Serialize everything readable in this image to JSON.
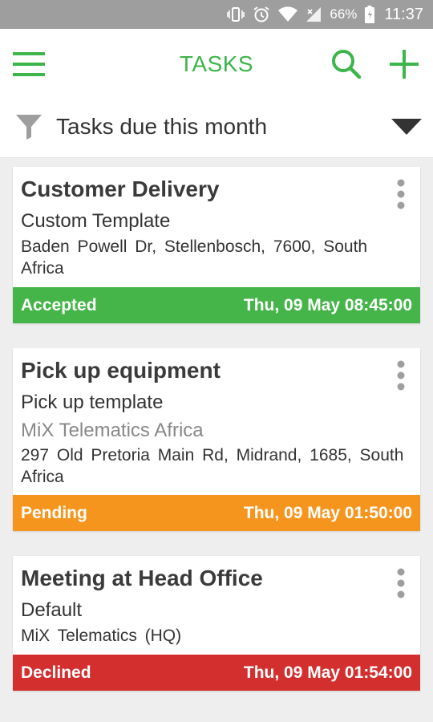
{
  "status_bar": {
    "battery": "66%",
    "time": "11:37",
    "icons": [
      "vibrate-icon",
      "alarm-icon",
      "wifi-icon",
      "signal-icon",
      "battery-icon"
    ]
  },
  "app_bar": {
    "title": "TASKS",
    "accent_color": "#3db54a",
    "icons": [
      "menu-icon",
      "search-icon",
      "add-icon"
    ]
  },
  "filter": {
    "label": "Tasks due this month",
    "icons": [
      "filter-icon",
      "dropdown-arrow-icon"
    ]
  },
  "tasks": [
    {
      "title": "Customer Delivery",
      "template": "Custom Template",
      "company": "",
      "address_line1": "Baden Powell Dr,  Stellenbosch,  7600,  South",
      "address_line2": "Africa",
      "status": "Accepted",
      "status_color": "#45b549",
      "due": "Thu, 09 May 08:45:00"
    },
    {
      "title": "Pick up equipment",
      "template": "Pick up template",
      "company": "MiX Telematics Africa",
      "address_line1": "297 Old Pretoria Main Rd,  Midrand,  1685,  South",
      "address_line2": "Africa",
      "status": "Pending",
      "status_color": "#f6951e",
      "due": "Thu, 09 May 01:50:00"
    },
    {
      "title": "Meeting at Head Office",
      "template": "Default",
      "company": "",
      "address_line1": "MiX Telematics (HQ)",
      "address_line2": "",
      "status": "Declined",
      "status_color": "#d32f2f",
      "due": "Thu, 09 May 01:54:00"
    }
  ]
}
